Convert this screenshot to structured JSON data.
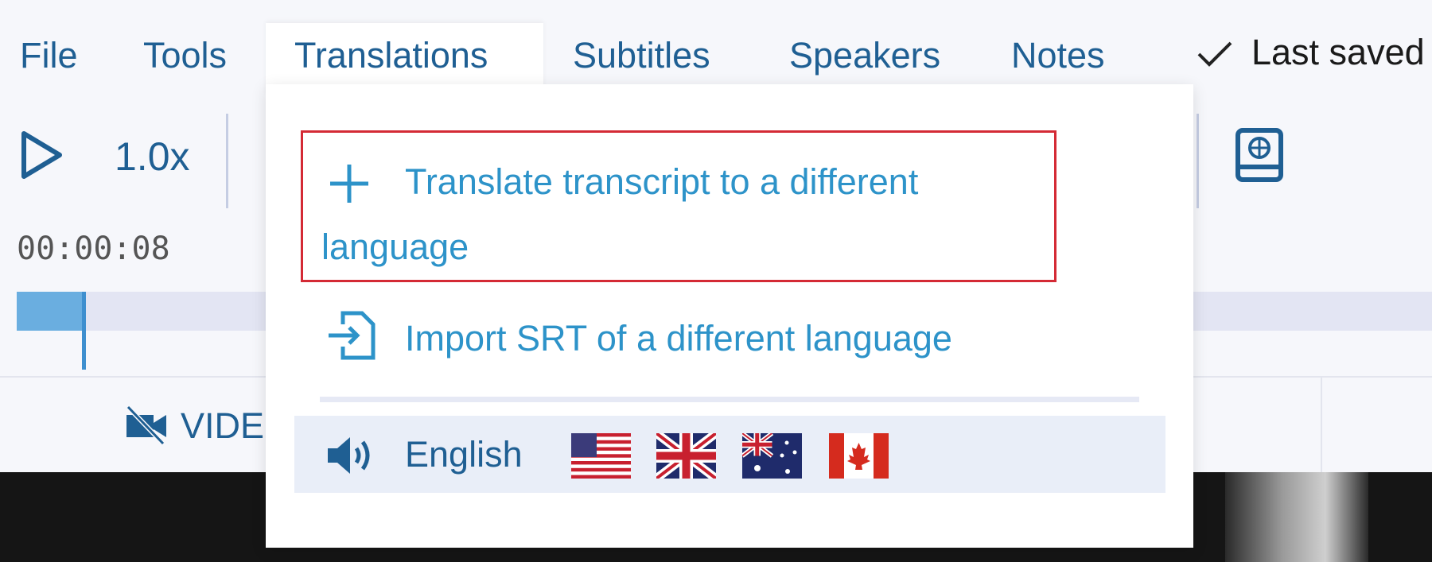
{
  "menu_bar": {
    "items": [
      "File",
      "Tools",
      "Translations",
      "Subtitles",
      "Speakers",
      "Notes"
    ],
    "active": "Translations",
    "save_status": "Last saved"
  },
  "toolbar": {
    "speed": "1.0x",
    "timestamp": "00:00:08",
    "playback_progress_fraction": 0.05
  },
  "lower_tabs": {
    "video_label": "VIDE"
  },
  "translations_menu": {
    "translate_label": "Translate transcript to a different",
    "translate_label_line2": "language",
    "import_label": "Import SRT of a different language",
    "language": "English",
    "flags": [
      "us-flag",
      "uk-flag",
      "australia-flag",
      "canada-flag"
    ]
  },
  "colors": {
    "menu_text": "#1f5f93",
    "dropdown_item": "#2d93c9",
    "highlight_box": "#d42a35",
    "language_row_bg": "#e9eef8",
    "progress_fill": "#6aaee0"
  }
}
